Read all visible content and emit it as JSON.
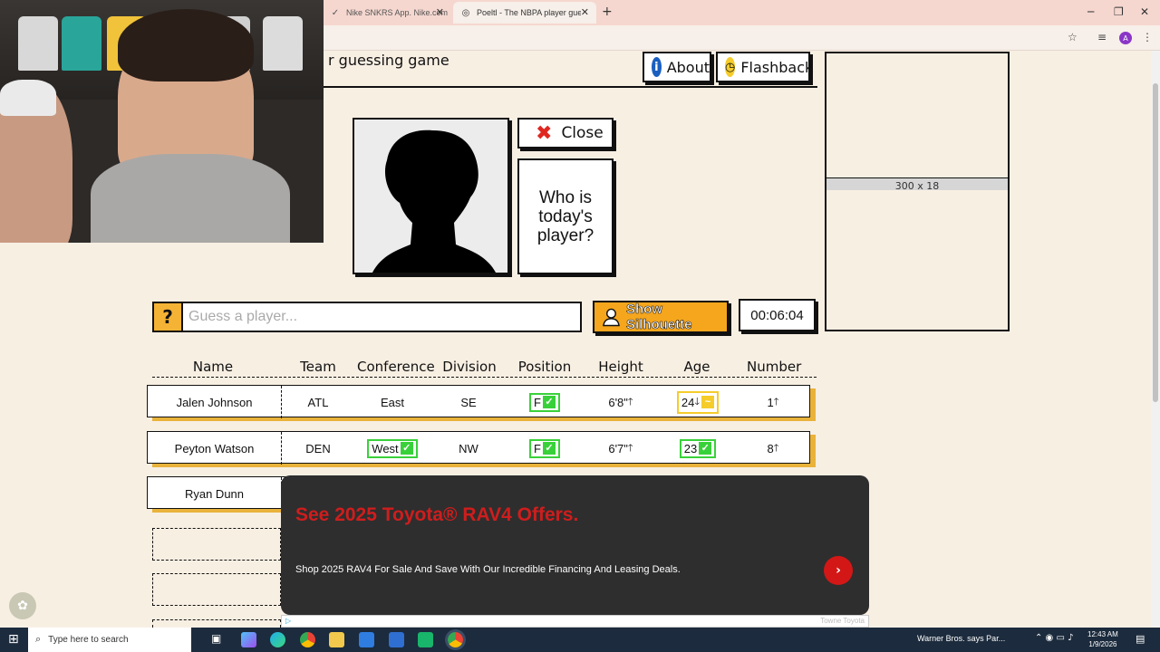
{
  "browser": {
    "tabs": [
      {
        "label": "Nike SNKRS App. Nike.com",
        "active": false
      },
      {
        "label": "Poeltl - The NBPA player guess...",
        "active": true
      }
    ],
    "new_tab": "+",
    "profile_initial": "A"
  },
  "page": {
    "subtitle": "r guessing game",
    "about_label": "About",
    "flashback_label": "Flashback",
    "ad_placeholder": "300 x 18",
    "close_label": "Close",
    "who_text": "Who is today's player?",
    "guess_placeholder": "Guess a player...",
    "guess_icon": "?",
    "show_silhouette_label": "Show Silhouette",
    "timer": "00:06:04"
  },
  "table": {
    "headers": [
      "Name",
      "Team",
      "Conference",
      "Division",
      "Position",
      "Height",
      "Age",
      "Number"
    ],
    "rows": [
      {
        "name": "Jalen Johnson",
        "team": "ATL",
        "conference": "East",
        "division": "SE",
        "position": "F",
        "height": "6'8\"",
        "age": "24",
        "number": "1"
      },
      {
        "name": "Peyton Watson",
        "team": "DEN",
        "conference": "West",
        "division": "NW",
        "position": "F",
        "height": "6'7\"",
        "age": "23",
        "number": "8"
      },
      {
        "name": "Ryan Dunn"
      }
    ],
    "arrows": {
      "up": "🡑",
      "down": "🡓"
    }
  },
  "ad": {
    "title": "See 2025 Toyota® RAV4 Offers.",
    "text": "Shop 2025 RAV4 For Sale And Save With Our Incredible Financing And Leasing Deals.",
    "sponsor": "Towne Toyota",
    "arrow": "›",
    "adchoices": "▷"
  },
  "taskbar": {
    "search_placeholder": "Type here to search",
    "news": "Warner Bros. says Par...",
    "time": "12:43 AM",
    "date": "1/9/2026"
  },
  "colors": {
    "accent": "#f5a61d",
    "correct": "#39d13a",
    "close": "#f5cc2a",
    "ad_red": "#cf1d1d"
  }
}
